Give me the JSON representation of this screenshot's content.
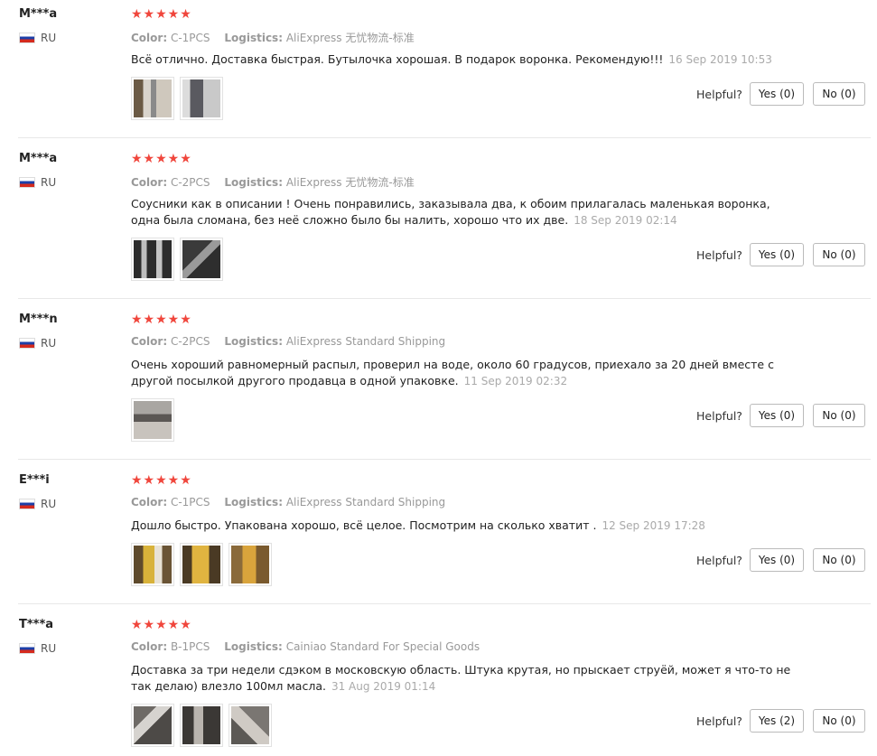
{
  "labels": {
    "color": "Color:",
    "logistics": "Logistics:",
    "helpful": "Helpful?",
    "yes": "Yes",
    "no": "No"
  },
  "colors": {
    "star": "#f0463c",
    "meta": "#999999",
    "divider": "#e8e8e8"
  },
  "reviews": [
    {
      "user": "M***a",
      "country": "RU",
      "rating": 5,
      "stars": "★★★★★",
      "color": "C-1PCS",
      "logistics": "AliExpress 无忧物流-标准",
      "text": "Всё отлично. Доставка быстрая. Бутылочка хорошая. В подарок воронка. Рекомендую!!!",
      "date": "16 Sep 2019 10:53",
      "photos": [
        "bottle-photo-1",
        "bottle-photo-2"
      ],
      "yes_label": "Yes (0)",
      "no_label": "No (0)"
    },
    {
      "user": "M***a",
      "country": "RU",
      "rating": 5,
      "stars": "★★★★★",
      "color": "C-2PCS",
      "logistics": "AliExpress 无忧物流-标准",
      "text": "Соусники как в описании ! Очень понравились, заказывала два, к обоим прилагалась маленькая воронка, одна была сломана, без неё сложно было бы налить, хорошо что их две.",
      "date": "18 Sep 2019 02:14",
      "photos": [
        "bottle-photo-1",
        "funnel-photo-2"
      ],
      "yes_label": "Yes (0)",
      "no_label": "No (0)"
    },
    {
      "user": "M***n",
      "country": "RU",
      "rating": 5,
      "stars": "★★★★★",
      "color": "C-2PCS",
      "logistics": "AliExpress Standard Shipping",
      "text": "Очень хороший равномерный распыл, проверил на воде, около 60 градусов, приехало за 20 дней вместе с другой посылкой другого продавца в одной упаковке.",
      "date": "11 Sep 2019 02:32",
      "photos": [
        "spray-photo-1"
      ],
      "yes_label": "Yes (0)",
      "no_label": "No (0)"
    },
    {
      "user": "E***i",
      "country": "RU",
      "rating": 5,
      "stars": "★★★★★",
      "color": "C-1PCS",
      "logistics": "AliExpress Standard Shipping",
      "text": "Дошло быстро. Упакована хорошо, всё целое. Посмотрим на сколько хватит .",
      "date": "12 Sep 2019 17:28",
      "photos": [
        "package-photo-1",
        "package-photo-2",
        "package-photo-3"
      ],
      "yes_label": "Yes (0)",
      "no_label": "No (0)"
    },
    {
      "user": "T***a",
      "country": "RU",
      "rating": 5,
      "stars": "★★★★★",
      "color": "B-1PCS",
      "logistics": "Cainiao Standard For Special Goods",
      "text": "Доставка за три недели сдэком в московскую область. Штука крутая, но прыскает струёй, может я что-то не так делаю) влезло 100мл масла.",
      "date": "31 Aug 2019 01:14",
      "photos": [
        "sprayer-photo-1",
        "sprayer-photo-2",
        "sprayer-photo-3"
      ],
      "yes_label": "Yes (2)",
      "no_label": "No (0)"
    }
  ]
}
